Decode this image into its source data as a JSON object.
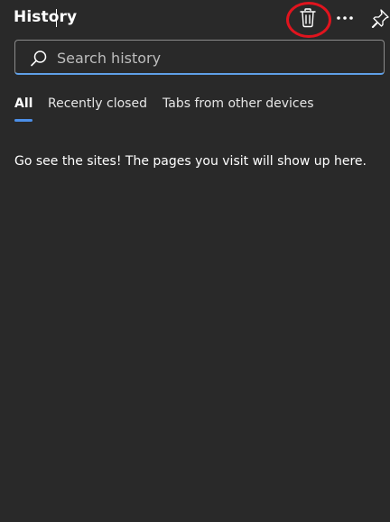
{
  "header": {
    "title": "History",
    "delete_icon": "trash-icon",
    "more_icon": "more-options-icon",
    "pin_icon": "pin-icon",
    "highlight_color": "#e0141e"
  },
  "search": {
    "placeholder": "Search history",
    "value": "",
    "focus_color": "#5fa0e8"
  },
  "tabs": [
    {
      "label": "All",
      "selected": true
    },
    {
      "label": "Recently closed",
      "selected": false
    },
    {
      "label": "Tabs from other devices",
      "selected": false
    }
  ],
  "empty_state": {
    "message": "Go see the sites! The pages you visit will show up here."
  },
  "colors": {
    "background": "#292929",
    "accent": "#4c8fe8"
  }
}
